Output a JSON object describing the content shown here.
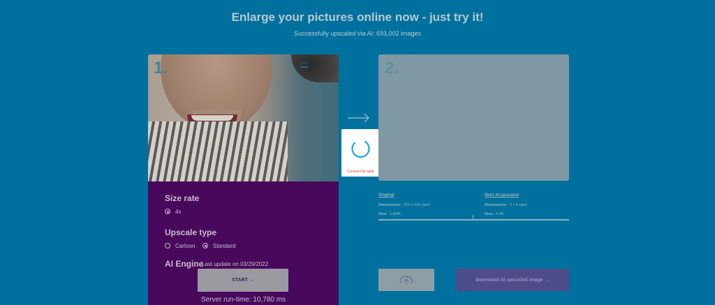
{
  "header": {
    "title": "Enlarge your pictures online now - just try it!",
    "subtitle": "Successfully upscaled via AI: 693,002 images"
  },
  "step1": {
    "number": "1.",
    "photo_label": "4x4",
    "size_rate_label": "Size rate",
    "size_options": [
      {
        "label": "4x",
        "checked": true
      }
    ],
    "upscale_type_label": "Upscale type",
    "upscale_options": [
      {
        "label": "Cartoon",
        "checked": false
      },
      {
        "label": "Standard",
        "checked": true
      }
    ],
    "ai_engine_label": "AI Engine",
    "ai_engine_update": "Last update on 03/29/2022",
    "start_label": "START →",
    "runtime": "Server run-time: 10,780 ms"
  },
  "progress": {
    "cancel_label": "Cancel the task"
  },
  "step2": {
    "number": "2."
  },
  "info": {
    "original_title": "Original",
    "original_dimensions_label": "Dimensions:",
    "original_dimensions_value": "629 x 416 pixel",
    "original_size_label": "Size:",
    "original_size_value": "1,8MB",
    "upscaled_title": "Nero AI upscaled",
    "upscaled_dimensions_label": "Dimensions:",
    "upscaled_dimensions_value": "0 x 0 pixel",
    "upscaled_size_label": "Size:",
    "upscaled_size_value": "0.0B"
  },
  "actions": {
    "upload_icon": "cloud-upload-icon",
    "download_label": "Download AI upscaled image →"
  },
  "colors": {
    "background": "#00719e",
    "panel": "#48085c",
    "spinner": "#1aa3e8",
    "cancel": "#d9381e"
  }
}
